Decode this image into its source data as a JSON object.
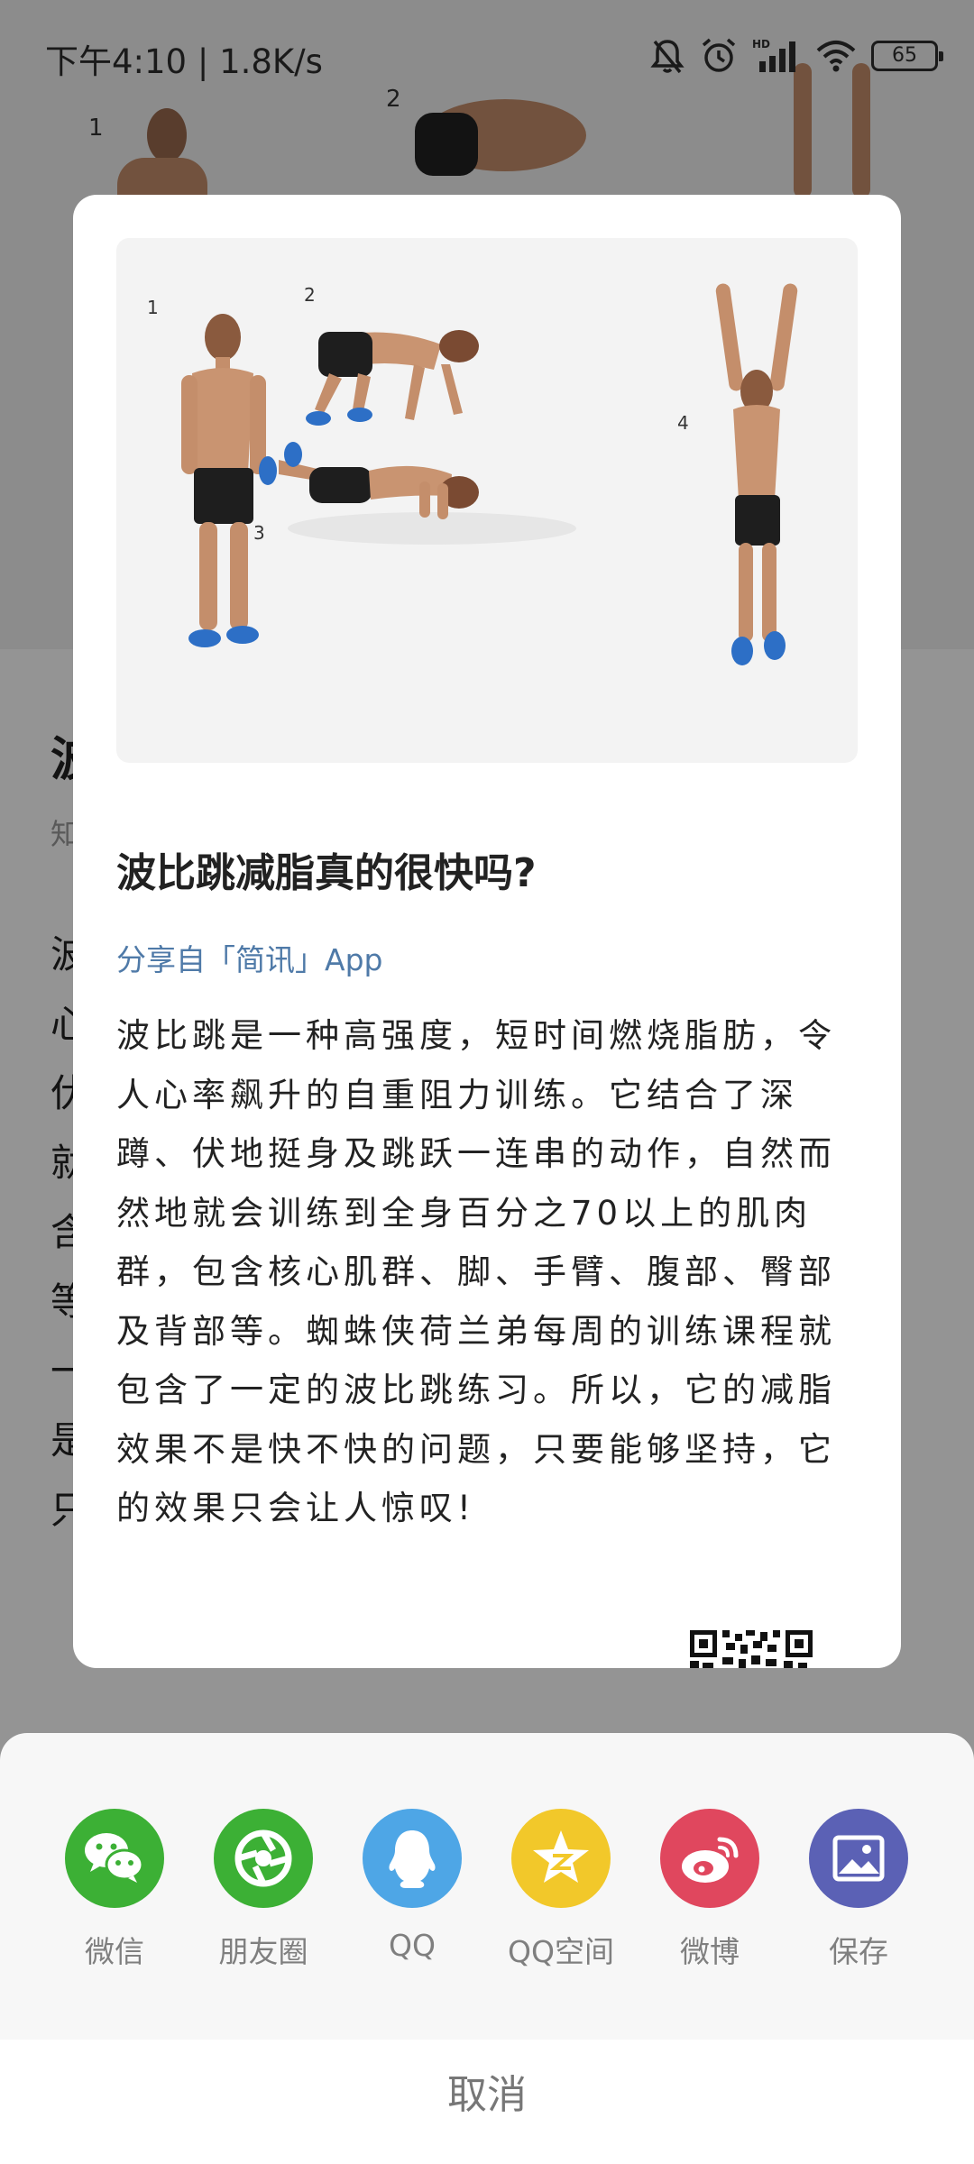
{
  "status_bar": {
    "time": "下午4:10 | 1.8K/s",
    "battery": "65",
    "icons": [
      "mute-bell-icon",
      "alarm-icon",
      "hd-signal-icon",
      "wifi-icon",
      "battery-icon"
    ]
  },
  "background": {
    "title": "波",
    "source": "知",
    "body_lines": [
      "波",
      "心",
      "伏",
      "就",
      "含",
      "等",
      "一",
      "是",
      "只"
    ]
  },
  "card": {
    "image_labels": [
      "1",
      "2",
      "3",
      "4"
    ],
    "title": "波比跳减脂真的很快吗?",
    "share_source": "分享自「简讯」App",
    "content": "波比跳是一种高强度，短时间燃烧脂肪，令人心率飙升的自重阻力训练。它结合了深蹲、伏地挺身及跳跃一连串的动作，自然而然地就会训练到全身百分之70以上的肌肉群，包含核心肌群、脚、手臂、腹部、臀部及背部等。蜘蛛侠荷兰弟每周的训练课程就包含了一定的波比跳练习。所以，它的减脂效果不是快不快的问题，只要能够坚持，它的效果只会让人惊叹!"
  },
  "share_sheet": {
    "targets": [
      {
        "label": "微信",
        "icon": "wechat-icon",
        "color": "#3cb035"
      },
      {
        "label": "朋友圈",
        "icon": "moments-icon",
        "color": "#3cb035"
      },
      {
        "label": "QQ",
        "icon": "qq-icon",
        "color": "#4ea6e6"
      },
      {
        "label": "QQ空间",
        "icon": "qzone-icon",
        "color": "#f2c82a"
      },
      {
        "label": "微博",
        "icon": "weibo-icon",
        "color": "#e0475e"
      },
      {
        "label": "保存",
        "icon": "save-image-icon",
        "color": "#5b61b5"
      }
    ],
    "cancel": "取消"
  }
}
